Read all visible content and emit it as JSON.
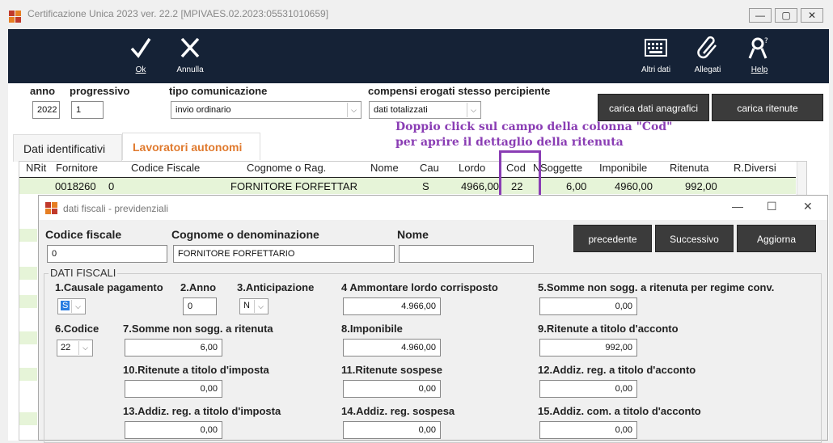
{
  "window": {
    "title": "Certificazione Unica 2023 ver. 22.2 [MPIVAES.02.2023:05531010659]",
    "controls": [
      "—",
      "▢",
      "✕"
    ]
  },
  "toolbar": {
    "ok": "Ok",
    "annulla": "Annulla",
    "altri_dati": "Altri dati",
    "allegati": "Allegati",
    "help": "Help"
  },
  "header": {
    "anno_label": "anno",
    "anno": "2022",
    "progressivo_label": "progressivo",
    "progressivo": "1",
    "tipo_label": "tipo comunicazione",
    "tipo": "invio ordinario",
    "compensi_label": "compensi erogati stesso percipiente",
    "compensi": "dati totalizzati",
    "btn_anagrafici": "carica dati anagrafici",
    "btn_ritenute": "carica ritenute"
  },
  "tabs": [
    {
      "label": "Dati identificativi"
    },
    {
      "label": "Lavoratori autonomi"
    }
  ],
  "annotation": {
    "line1": "Doppio click sul campo della colonna \"Cod\"",
    "line2": "per aprire il dettaglio della ritenuta"
  },
  "table": {
    "headers": [
      "NRit",
      "Fornitore",
      "Codice Fiscale",
      "Cognome o Rag.",
      "Nome",
      "Cau",
      "Lordo",
      "Cod",
      "N",
      "Soggette",
      "Imponibile",
      "Ritenuta",
      "R.Diversi"
    ],
    "row": {
      "fornitore": "0018260",
      "cf": "0",
      "cognome": "FORNITORE FORFETTAR",
      "cau": "S",
      "lordo": "4966,00",
      "cod": "22",
      "soggette": "6,00",
      "imponibile": "4960,00",
      "ritenuta": "992,00"
    }
  },
  "dialog": {
    "title": "dati fiscali - previdenziali",
    "cf_label": "Codice fiscale",
    "cf": "0",
    "cognome_label": "Cognome o denominazione",
    "cognome": "FORNITORE FORFETTARIO",
    "nome_label": "Nome",
    "nome": "",
    "btn_precedente": "precedente",
    "btn_successivo": "Successivo",
    "btn_aggiorna": "Aggiorna",
    "section": "DATI FISCALI",
    "f1_label": "1.Causale pagamento",
    "f1": "S",
    "f2_label": "2.Anno",
    "f2": "0",
    "f3_label": "3.Anticipazione",
    "f3": "N",
    "f4_label": "4 Ammontare lordo corrisposto",
    "f4": "4.966,00",
    "f5_label": "5.Somme non sogg. a ritenuta per regime conv.",
    "f5": "0,00",
    "f6_label": "6.Codice",
    "f6": "22",
    "f7_label": "7.Somme non sogg. a ritenuta",
    "f7": "6,00",
    "f8_label": "8.Imponibile",
    "f8": "4.960,00",
    "f9_label": "9.Ritenute a titolo d'acconto",
    "f9": "992,00",
    "f10_label": "10.Ritenute a titolo d'imposta",
    "f10": "0,00",
    "f11_label": "11.Ritenute sospese",
    "f11": "0,00",
    "f12_label": "12.Addiz. reg. a titolo d'acconto",
    "f12": "0,00",
    "f13_label": "13.Addiz. reg. a titolo d'imposta",
    "f13": "0,00",
    "f14_label": "14.Addiz. reg. sospesa",
    "f14": "0,00",
    "f15_label": "15.Addiz. com. a titolo d'acconto",
    "f15": "0,00"
  },
  "colors": {
    "toolbar_bg": "#152236",
    "annotation": "#8a3db4",
    "active_tab": "#e07a2e",
    "row_highlight": "#e6f4d8"
  }
}
